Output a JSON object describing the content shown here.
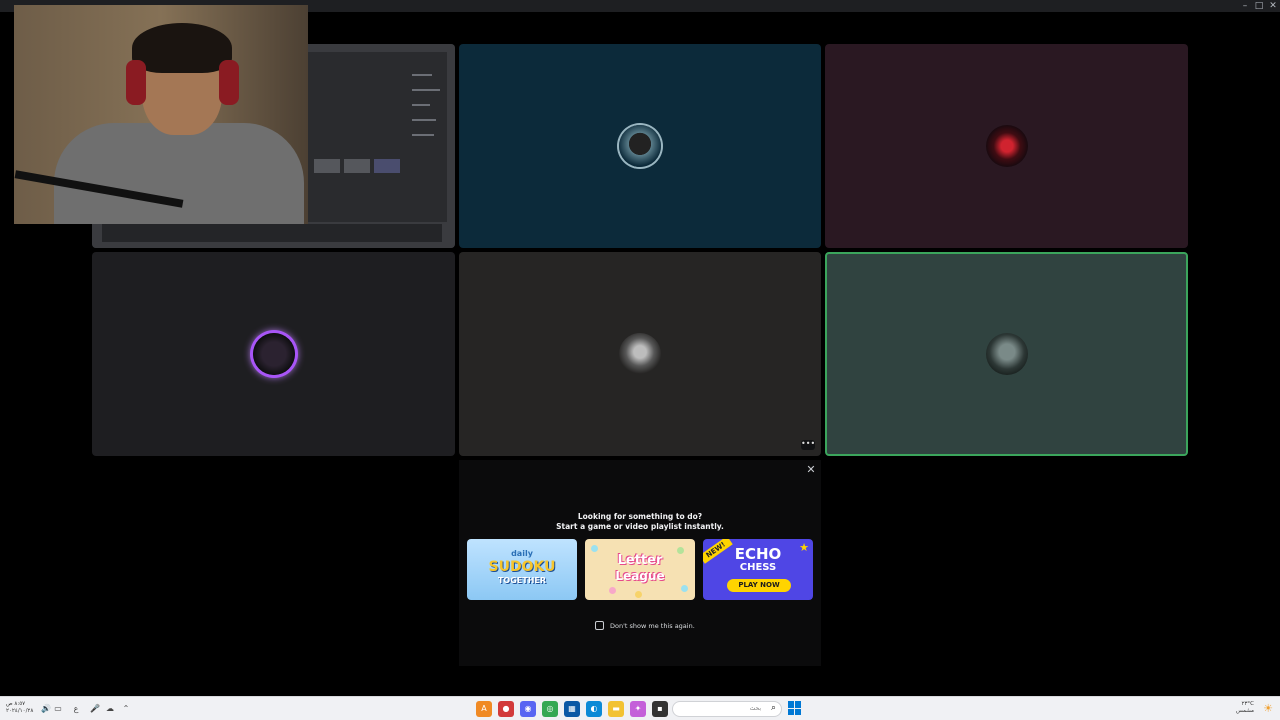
{
  "window": {
    "controls": {
      "minimize": "–",
      "maximize": "□",
      "close": "✕"
    }
  },
  "call": {
    "tiles": [
      {
        "id": "screenshare",
        "kind": "screen-share"
      },
      {
        "id": "user-2",
        "avatar_ring": "#9ab6c1",
        "bg": "#0c2a3a"
      },
      {
        "id": "user-3",
        "bg": "#2a1822"
      },
      {
        "id": "user-4",
        "speaking_ring": "#a855f7",
        "bg": "#1e1e21"
      },
      {
        "id": "user-5",
        "bg": "#262524",
        "more_label": "•••"
      },
      {
        "id": "user-6",
        "selected_border": "#3ba55c",
        "bg": "#304340"
      }
    ]
  },
  "activity_prompt": {
    "close_label": "✕",
    "title_line1": "Looking for something to do?",
    "title_line2": "Start a game or video playlist instantly.",
    "games": {
      "sudoku": {
        "daily": "daily",
        "title": "SUDOKU",
        "subtitle": "TOGETHER"
      },
      "letter_league": {
        "line1": "Letter",
        "line2": "League"
      },
      "echo_chess": {
        "badge": "NEW!",
        "title": "ECHO",
        "subtitle": "CHESS",
        "cta": "PLAY NOW",
        "star": "★"
      }
    },
    "dont_show_label": "Don't show me this again.",
    "dont_show_checked": false
  },
  "taskbar": {
    "clock_time": "٨:٥٧ ص",
    "clock_date": "٢٠٢٤/١٠/٢٨",
    "tray_icons": [
      "speaker-icon",
      "display-icon",
      "language-icon",
      "microphone-icon",
      "cloud-icon",
      "chevron-up-icon"
    ],
    "tray_glyphs": [
      "🔊",
      "▭",
      "ع",
      "🎤",
      "☁",
      "⌃"
    ],
    "apps": [
      {
        "name": "app-a",
        "glyph": "A",
        "color": "#f08a24"
      },
      {
        "name": "app-b",
        "glyph": "●",
        "color": "#d23a3a"
      },
      {
        "name": "discord",
        "glyph": "◉",
        "color": "#5865f2"
      },
      {
        "name": "chrome",
        "glyph": "◎",
        "color": "#34a853"
      },
      {
        "name": "calculator",
        "glyph": "▦",
        "color": "#0a58a5"
      },
      {
        "name": "edge",
        "glyph": "◐",
        "color": "#0c8ad6"
      },
      {
        "name": "file-explorer",
        "glyph": "▬",
        "color": "#f2c232"
      },
      {
        "name": "copilot",
        "glyph": "✦",
        "color": "#c45fd9"
      },
      {
        "name": "app-generic",
        "glyph": "▪",
        "color": "#333333"
      }
    ],
    "search_placeholder": "بحث",
    "search_icon": "⌕",
    "weather_temp": "٢٣°C",
    "weather_desc": "مشمس"
  }
}
